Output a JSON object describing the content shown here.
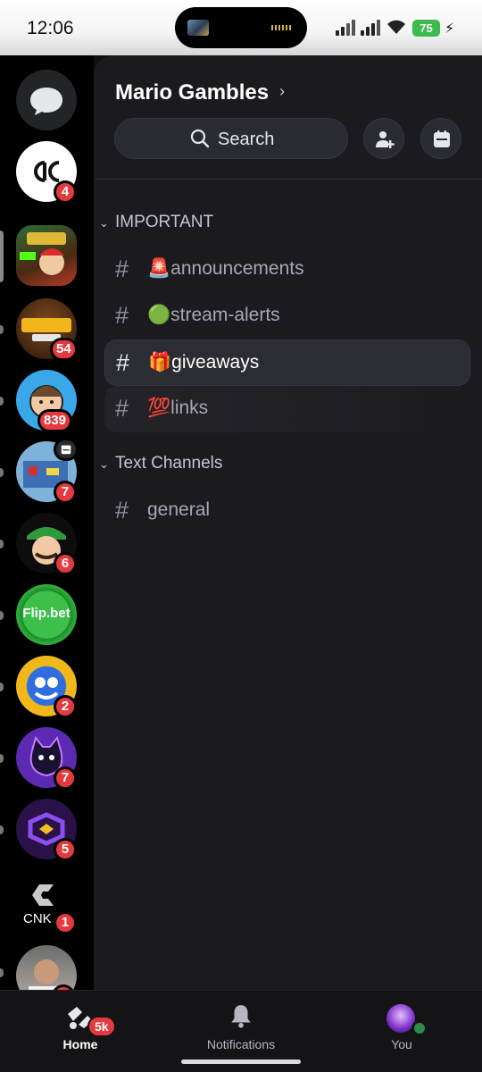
{
  "status_bar": {
    "time": "12:06",
    "battery": "75"
  },
  "server_rail": {
    "dm_button_icon": "chat-bubble-icon",
    "servers": [
      {
        "name": "ac",
        "badge": "4"
      },
      {
        "name": "MARIO GAMBLES",
        "badge": ""
      },
      {
        "name": "DUMA TOWN",
        "badge": "54"
      },
      {
        "name": "avatar-server",
        "badge": "839"
      },
      {
        "name": "pixel-server",
        "badge": "7"
      },
      {
        "name": "luigi-server",
        "badge": "6"
      },
      {
        "name": "Flip.bet",
        "badge": ""
      },
      {
        "name": "smiley-server",
        "badge": "2"
      },
      {
        "name": "cat-server",
        "badge": "7"
      },
      {
        "name": "purple-server",
        "badge": "5"
      },
      {
        "name": "CNK",
        "badge": "1"
      },
      {
        "name": "photo-server",
        "badge": ""
      }
    ]
  },
  "server": {
    "name": "Mario Gambles",
    "search_label": "Search"
  },
  "categories": [
    {
      "name": "IMPORTANT",
      "channels": [
        {
          "emoji": "🚨",
          "name": "announcements"
        },
        {
          "emoji": "🟢",
          "name": "stream-alerts"
        },
        {
          "emoji": "🎁",
          "name": "giveaways"
        },
        {
          "emoji": "💯",
          "name": "links"
        }
      ]
    },
    {
      "name": "Text Channels",
      "channels": [
        {
          "emoji": "",
          "name": "general"
        }
      ]
    }
  ],
  "bottom_nav": {
    "home_label": "Home",
    "home_badge": "5k",
    "notifications_label": "Notifications",
    "you_label": "You"
  },
  "colors": {
    "badge": "#e3393f",
    "online": "#2e8b47",
    "battery": "#3dbb4f"
  }
}
